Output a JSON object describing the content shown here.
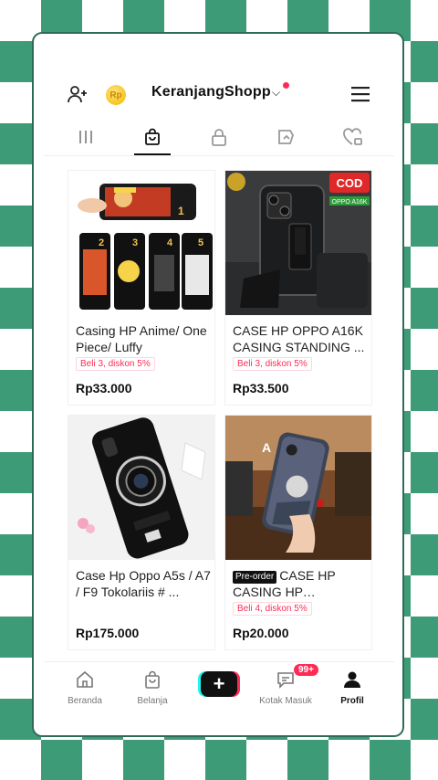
{
  "header": {
    "shop_name": "KeranjangShopp",
    "coin_label": "Rp"
  },
  "products": [
    {
      "title": "Casing HP Anime/ One Piece/ Luffy",
      "promo": "Beli 3, diskon 5%",
      "price": "Rp33.000",
      "preorder": ""
    },
    {
      "title": "CASE HP OPPO A16K CASING STANDING ...",
      "promo": "Beli 3, diskon 5%",
      "price": "Rp33.500",
      "preorder": "",
      "badge": "COD",
      "badge_sub": "OPPO A16K"
    },
    {
      "title": "Case Hp Oppo A5s / A7 / F9 Tokolariis # ...",
      "promo": "",
      "price": "Rp175.000",
      "preorder": ""
    },
    {
      "title": "CASE HP CASING HP SOFTCA...",
      "promo": "Beli 4, diskon 5%",
      "price": "Rp20.000",
      "preorder": "Pre-order"
    }
  ],
  "nav": {
    "home": "Beranda",
    "shop": "Belanja",
    "inbox": "Kotak Masuk",
    "inbox_badge": "99+",
    "profile": "Profil"
  },
  "colors": {
    "accent": "#fe2c55",
    "checker": "#3e9b77"
  }
}
